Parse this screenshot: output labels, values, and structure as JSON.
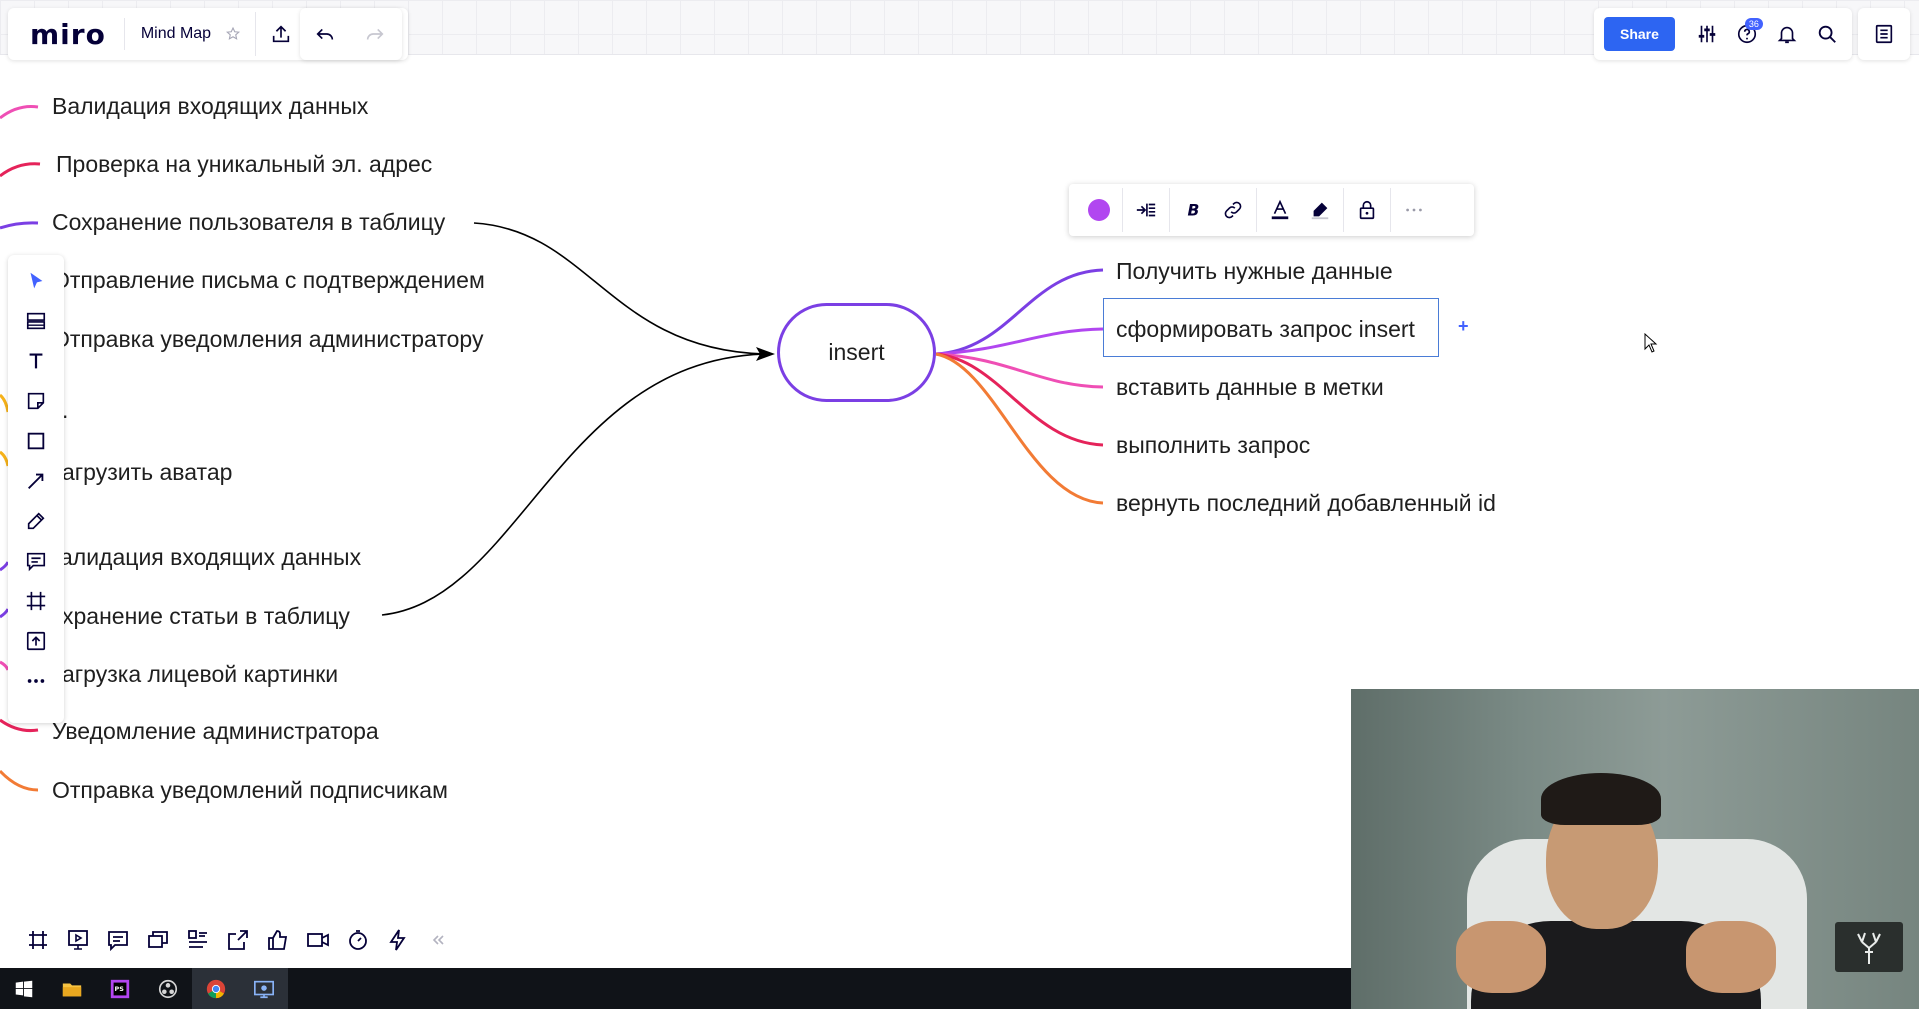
{
  "app": {
    "logo": "miro",
    "board_name": "Mind Map",
    "share_label": "Share",
    "help_badge": "36"
  },
  "left_nodes": [
    {
      "text": "Валидация входящих данных",
      "color": "#ef4fb5"
    },
    {
      "text": "Проверка на уникальный эл. адрес",
      "color": "#e5235a"
    },
    {
      "text": "Сохранение пользователя в таблицу",
      "color": "#7b3fe4"
    },
    {
      "text": "Отправление письма с подтверждением",
      "color": "#7b3fe4"
    },
    {
      "text": "Отправка уведомления администратору",
      "color": "#ef4fb5"
    },
    {
      "text": ".",
      "color": "#f6b21a"
    },
    {
      "text": "агрузить аватар",
      "color": "#f6b21a"
    },
    {
      "text": "алидация входящих данных",
      "color": "#7b3fe4"
    },
    {
      "text": "хранение статьи в таблицу",
      "color": "#7b3fe4"
    },
    {
      "text": "агрузка лицевой картинки",
      "color": "#ef4fb5"
    },
    {
      "text": "Уведомление администратора",
      "color": "#e5235a"
    },
    {
      "text": "Отправка уведомлений подписчикам",
      "color": "#f27b35"
    }
  ],
  "center_node": {
    "text": "insert",
    "color": "#7b3fe4"
  },
  "right_nodes": [
    {
      "text": "Получить нужные данные",
      "color": "#7b3fe4"
    },
    {
      "text": "сформировать запрос insert",
      "color": "#b146f0"
    },
    {
      "text": "вставить данные в метки",
      "color": "#ef4fb5"
    },
    {
      "text": "выполнить запрос",
      "color": "#e5235a"
    },
    {
      "text": "вернуть последний добавленный id",
      "color": "#f27b35"
    }
  ],
  "context_toolbar": {
    "color": "#b146f0",
    "icons": [
      "color-swatch",
      "align-icon",
      "bold-icon",
      "link-icon",
      "text-color-icon",
      "highlight-icon",
      "lock-icon",
      "more-icon"
    ]
  },
  "left_toolbar_icons": [
    "select-icon",
    "templates-icon",
    "text-icon",
    "sticky-note-icon",
    "shape-icon",
    "connection-line-icon",
    "pen-icon",
    "comment-icon",
    "frame-icon",
    "upload-icon",
    "more-tools-icon"
  ],
  "bottom_toolbar_icons": [
    "frames-icon",
    "presentation-icon",
    "comments-icon",
    "cards-icon",
    "kanban-icon",
    "screen-share-icon",
    "voting-icon",
    "video-icon",
    "timer-icon",
    "apps-icon",
    "collapse-icon"
  ],
  "taskbar_icons": [
    "windows-start-icon",
    "file-explorer-icon",
    "phpstorm-icon",
    "obs-icon",
    "chrome-icon",
    "screen-recorder-icon"
  ]
}
